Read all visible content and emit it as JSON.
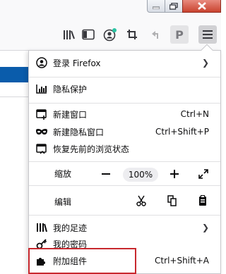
{
  "window": {
    "buttons": [
      "minimize",
      "maximize",
      "close"
    ]
  },
  "toolbar": {
    "icons": [
      "library-icon",
      "sidebar-icon",
      "account-icon",
      "crop-icon",
      "undo-icon"
    ],
    "p_label": "P",
    "menu_icon": "hamburger-menu-icon"
  },
  "menu": {
    "sign_in": {
      "label": "登录 Firefox",
      "icon": "account-circle-icon"
    },
    "privacy": {
      "label": "隐私保护",
      "icon": "chart-icon"
    },
    "new_window": {
      "label": "新建窗口",
      "shortcut": "Ctrl+N",
      "icon": "new-window-icon"
    },
    "new_private": {
      "label": "新建隐私窗口",
      "shortcut": "Ctrl+Shift+P",
      "icon": "private-mask-icon"
    },
    "restore": {
      "label": "恢复先前的浏览状态",
      "icon": "restore-session-icon"
    },
    "zoom": {
      "label": "缩放",
      "value": "100%"
    },
    "edit": {
      "label": "编辑"
    },
    "library": {
      "label": "我的足迹",
      "icon": "library-icon"
    },
    "logins": {
      "label": "我的密码",
      "icon": "key-icon"
    },
    "addons": {
      "label": "附加组件",
      "shortcut": "Ctrl+Shift+A",
      "icon": "puzzle-icon"
    }
  },
  "colors": {
    "accent_blue": "#0a5cab",
    "highlight_red": "#c8282e",
    "close_red": "#c9432f"
  }
}
